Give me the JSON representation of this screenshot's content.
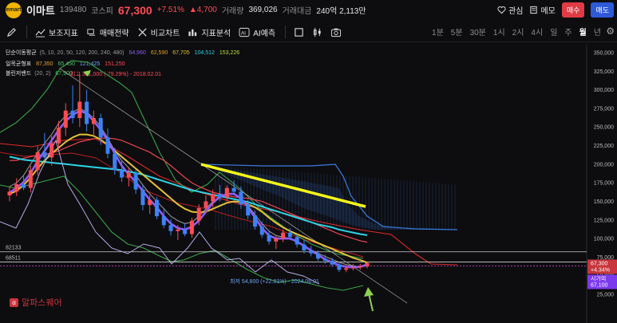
{
  "header": {
    "logo_text": "emart",
    "stock_name": "이마트",
    "stock_code": "139480",
    "market": "코스피",
    "price": "67,300",
    "change_pct": "+7.51%",
    "change_amount": "▲4,700",
    "volume_label": "거래량",
    "volume_value": "369,026",
    "amount_label": "거래대금",
    "amount_value": "240억 2,113만",
    "watch_label": "관심",
    "memo_label": "메모",
    "buy_label": "매수",
    "sell_label": "매도"
  },
  "toolbar": {
    "indicators_label": "보조지표",
    "strategy_label": "매매전략",
    "compare_label": "비교차트",
    "analysis_label": "지표분석",
    "ai_label": "AI예측",
    "periods": [
      "1분",
      "5분",
      "30분",
      "1시",
      "2시",
      "4시",
      "일",
      "주",
      "월",
      "년"
    ],
    "active_period": "월"
  },
  "legend": {
    "ma_label": "단순이동평균",
    "ma_params": "(5, 10, 20, 50, 120, 200, 240, 480)",
    "ma_values": [
      "64,960",
      "62,590",
      "67,705",
      "104,512",
      "153,226"
    ],
    "ichimoku_label": "일목균형표",
    "ichimoku_values": [
      "87,350",
      "65,450",
      "121,425",
      "151,250"
    ],
    "bollinger_label": "볼린저밴드",
    "bollinger_params": "(20, 2)",
    "bollinger_value": "67,900",
    "high_annotation": "최고 321,000 (-79.29%) - 2018.02.01",
    "low_annotation": "최저 54,800 (+22.81%) - 2024.06.01"
  },
  "colors": {
    "background": "#0d0d0f",
    "up": "#ff4b55",
    "down": "#3b82f6",
    "accent_yellow": "#f4f41a",
    "arrow_green": "#8fd14f"
  },
  "levels": {
    "line_a": "82133",
    "line_b": "68511"
  },
  "price_badge": {
    "price": "67,300",
    "pct": "+4.34%",
    "time_label": "시가의",
    "time_value": "67,100"
  },
  "watermark": "알파스퀘어",
  "bottom_label": "",
  "chart_data": {
    "type": "line",
    "title": "",
    "yticks": [
      350000,
      325000,
      300000,
      275000,
      250000,
      225000,
      200000,
      175000,
      150000,
      125000,
      100000,
      75000,
      50000,
      25000
    ],
    "ylim": [
      20000,
      355000
    ],
    "candles": [
      {
        "o": 158000,
        "h": 170000,
        "l": 150000,
        "c": 163000
      },
      {
        "o": 163000,
        "h": 181000,
        "l": 157000,
        "c": 173000
      },
      {
        "o": 173000,
        "h": 186000,
        "l": 165000,
        "c": 168000
      },
      {
        "o": 168000,
        "h": 198000,
        "l": 162000,
        "c": 192000
      },
      {
        "o": 192000,
        "h": 224000,
        "l": 185000,
        "c": 216000
      },
      {
        "o": 216000,
        "h": 242000,
        "l": 205000,
        "c": 209000
      },
      {
        "o": 209000,
        "h": 238000,
        "l": 198000,
        "c": 228000
      },
      {
        "o": 228000,
        "h": 258000,
        "l": 220000,
        "c": 249000
      },
      {
        "o": 249000,
        "h": 282000,
        "l": 238000,
        "c": 272000
      },
      {
        "o": 272000,
        "h": 306000,
        "l": 255000,
        "c": 262000
      },
      {
        "o": 262000,
        "h": 321000,
        "l": 250000,
        "c": 284000
      },
      {
        "o": 284000,
        "h": 300000,
        "l": 244000,
        "c": 254000
      },
      {
        "o": 254000,
        "h": 272000,
        "l": 236000,
        "c": 262000
      },
      {
        "o": 262000,
        "h": 268000,
        "l": 226000,
        "c": 236000
      },
      {
        "o": 236000,
        "h": 248000,
        "l": 208000,
        "c": 214000
      },
      {
        "o": 214000,
        "h": 222000,
        "l": 186000,
        "c": 192000
      },
      {
        "o": 192000,
        "h": 205000,
        "l": 176000,
        "c": 182000
      },
      {
        "o": 182000,
        "h": 196000,
        "l": 170000,
        "c": 188000
      },
      {
        "o": 188000,
        "h": 192000,
        "l": 160000,
        "c": 166000
      },
      {
        "o": 166000,
        "h": 172000,
        "l": 138000,
        "c": 145000
      },
      {
        "o": 145000,
        "h": 158000,
        "l": 133000,
        "c": 152000
      },
      {
        "o": 152000,
        "h": 156000,
        "l": 126000,
        "c": 130000
      },
      {
        "o": 130000,
        "h": 140000,
        "l": 114000,
        "c": 118000
      },
      {
        "o": 118000,
        "h": 126000,
        "l": 104000,
        "c": 110000
      },
      {
        "o": 110000,
        "h": 118000,
        "l": 98000,
        "c": 112000
      },
      {
        "o": 112000,
        "h": 121000,
        "l": 103000,
        "c": 106000
      },
      {
        "o": 106000,
        "h": 128000,
        "l": 101000,
        "c": 124000
      },
      {
        "o": 124000,
        "h": 146000,
        "l": 118000,
        "c": 141000
      },
      {
        "o": 141000,
        "h": 158000,
        "l": 134000,
        "c": 150000
      },
      {
        "o": 150000,
        "h": 166000,
        "l": 142000,
        "c": 160000
      },
      {
        "o": 160000,
        "h": 172000,
        "l": 150000,
        "c": 155000
      },
      {
        "o": 155000,
        "h": 172000,
        "l": 150000,
        "c": 168000
      },
      {
        "o": 168000,
        "h": 178000,
        "l": 158000,
        "c": 163000
      },
      {
        "o": 163000,
        "h": 170000,
        "l": 140000,
        "c": 146000
      },
      {
        "o": 146000,
        "h": 152000,
        "l": 126000,
        "c": 131000
      },
      {
        "o": 131000,
        "h": 138000,
        "l": 112000,
        "c": 116000
      },
      {
        "o": 116000,
        "h": 123000,
        "l": 101000,
        "c": 105000
      },
      {
        "o": 105000,
        "h": 111000,
        "l": 92000,
        "c": 96000
      },
      {
        "o": 96000,
        "h": 104000,
        "l": 86000,
        "c": 100000
      },
      {
        "o": 100000,
        "h": 112000,
        "l": 95000,
        "c": 108000
      },
      {
        "o": 108000,
        "h": 114000,
        "l": 98000,
        "c": 102000
      },
      {
        "o": 102000,
        "h": 106000,
        "l": 88000,
        "c": 92000
      },
      {
        "o": 92000,
        "h": 98000,
        "l": 80000,
        "c": 84000
      },
      {
        "o": 84000,
        "h": 90000,
        "l": 76000,
        "c": 80000
      },
      {
        "o": 80000,
        "h": 84000,
        "l": 70000,
        "c": 73000
      },
      {
        "o": 73000,
        "h": 78000,
        "l": 66000,
        "c": 70000
      },
      {
        "o": 70000,
        "h": 74000,
        "l": 62000,
        "c": 65000
      },
      {
        "o": 65000,
        "h": 69000,
        "l": 55000,
        "c": 58000
      },
      {
        "o": 58000,
        "h": 64000,
        "l": 54800,
        "c": 60000
      },
      {
        "o": 60000,
        "h": 66000,
        "l": 57000,
        "c": 61000
      },
      {
        "o": 61000,
        "h": 66000,
        "l": 58000,
        "c": 62600
      },
      {
        "o": 62600,
        "h": 68000,
        "l": 60000,
        "c": 67300
      }
    ],
    "series": [
      {
        "name": "",
        "color": "#ffffff",
        "values": [
          170000,
          175000,
          185000,
          200000,
          215000,
          228000,
          240000,
          255000,
          265000,
          270000,
          275000,
          270000,
          262000,
          250000,
          235000,
          218000,
          205000,
          195000,
          185000,
          172000,
          160000,
          150000,
          140000,
          130000,
          124000,
          120000,
          122000,
          130000,
          140000,
          150000,
          156000,
          160000,
          160000,
          154000,
          144000,
          132000,
          120000,
          110000,
          104000,
          102000,
          100000,
          96000,
          90000,
          85000,
          80000,
          76000,
          72000,
          68000,
          65000,
          63000,
          62000,
          63000
        ]
      },
      {
        "name": "",
        "color": "#ff4b55",
        "values": [
          205000,
          205000,
          208000,
          210000,
          212000,
          213000,
          215000,
          218000,
          222000,
          226000,
          230000,
          232000,
          234000,
          235000,
          235000,
          234000,
          232000,
          228000,
          224000,
          220000,
          216000,
          210000,
          205000,
          198000,
          190000,
          182000,
          175000,
          170000,
          166000,
          162000,
          160000,
          158000,
          156000,
          155000,
          154000,
          152000,
          150000,
          146000,
          142000,
          138000,
          134000,
          130000,
          126000,
          122000,
          118000,
          114000,
          110000,
          106000,
          103000,
          100000,
          97000,
          95000
        ]
      },
      {
        "name": "",
        "color": "#2dd4e6",
        "values": [
          210000,
          208000,
          206000,
          205000,
          204000,
          203000,
          202000,
          201000,
          200000,
          199000,
          198000,
          197000,
          196000,
          195000,
          194000,
          193000,
          192000,
          190000,
          188000,
          186000,
          183000,
          180000,
          177000,
          174000,
          171000,
          168000,
          165000,
          163000,
          161000,
          159000,
          157000,
          155000,
          153000,
          151000,
          149000,
          146000,
          143000,
          140000,
          137000,
          134000,
          131000,
          128000,
          125000,
          122000,
          119000,
          117000,
          115000,
          112000,
          110000,
          108000,
          106000,
          104500
        ]
      },
      {
        "name": "",
        "color": "#e2c13a",
        "values": [
          160000,
          164000,
          172000,
          182000,
          194000,
          205000,
          214000,
          222000,
          230000,
          236000,
          240000,
          240000,
          238000,
          233000,
          226000,
          218000,
          210000,
          202000,
          194000,
          186000,
          178000,
          170000,
          162000,
          154000,
          146000,
          140000,
          136000,
          135000,
          136000,
          140000,
          144000,
          148000,
          150000,
          149000,
          146000,
          142000,
          136000,
          128000,
          121000,
          115000,
          110000,
          106000,
          102000,
          98000,
          94000,
          90000,
          86000,
          82000,
          78000,
          74000,
          71000,
          67700
        ]
      },
      {
        "name": "",
        "color": "#8e5cf7",
        "values": [
          162000,
          168000,
          176000,
          188000,
          204000,
          218000,
          232000,
          246000,
          258000,
          266000,
          272000,
          268000,
          258000,
          246000,
          232000,
          214000,
          198000,
          186000,
          176000,
          164000,
          152000,
          142000,
          130000,
          120000,
          114000,
          112000,
          116000,
          124000,
          136000,
          148000,
          156000,
          160000,
          160000,
          154000,
          142000,
          128000,
          114000,
          104000,
          100000,
          100000,
          100000,
          96000,
          90000,
          84000,
          78000,
          72000,
          68000,
          64000,
          62000,
          61000,
          62000,
          64960
        ]
      }
    ]
  }
}
